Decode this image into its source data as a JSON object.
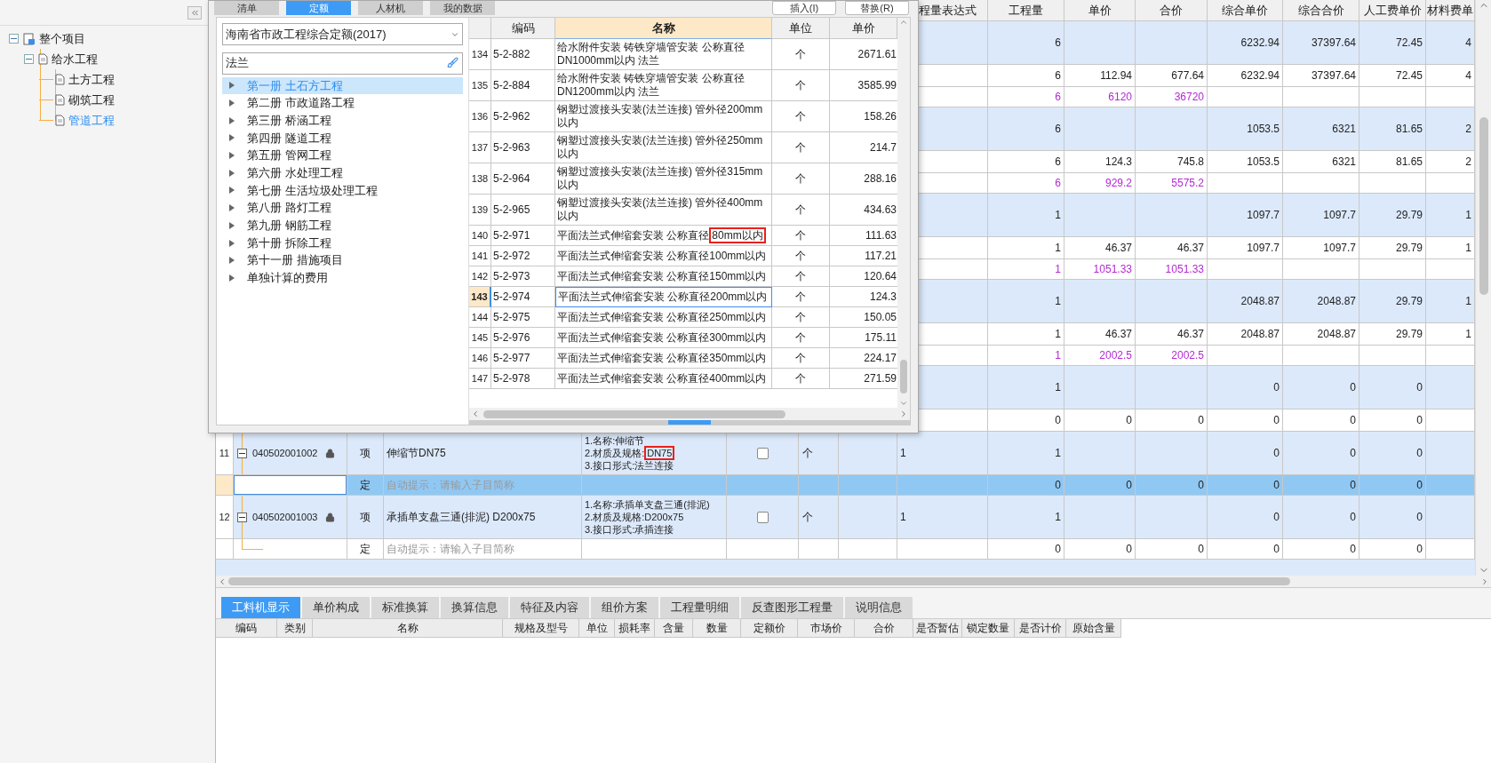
{
  "sidebar": {
    "tree": [
      {
        "label": "整个项目",
        "kind": "project",
        "expanded": true,
        "selected": false,
        "children": [
          {
            "label": "给水工程",
            "kind": "file",
            "expanded": true,
            "selected": false,
            "children": [
              {
                "label": "土方工程",
                "kind": "file",
                "selected": false
              },
              {
                "label": "砌筑工程",
                "kind": "file",
                "selected": false
              },
              {
                "label": "管道工程",
                "kind": "file",
                "selected": true
              }
            ]
          }
        ]
      }
    ]
  },
  "dialog": {
    "tabs": [
      {
        "label": "清单",
        "selected": false
      },
      {
        "label": "定额",
        "selected": true
      },
      {
        "label": "人材机",
        "selected": false
      },
      {
        "label": "我的数据",
        "selected": false
      }
    ],
    "buttons": [
      "插入(I)",
      "替换(R)"
    ],
    "library": "海南省市政工程综合定额(2017)",
    "search": {
      "value": "法兰"
    },
    "chapters": [
      {
        "label": "第一册 土石方工程",
        "selected": true
      },
      {
        "label": "第二册 市政道路工程",
        "selected": false
      },
      {
        "label": "第三册 桥涵工程",
        "selected": false
      },
      {
        "label": "第四册 隧道工程",
        "selected": false
      },
      {
        "label": "第五册 管网工程",
        "selected": false
      },
      {
        "label": "第六册 水处理工程",
        "selected": false
      },
      {
        "label": "第七册 生活垃圾处理工程",
        "selected": false
      },
      {
        "label": "第八册 路灯工程",
        "selected": false
      },
      {
        "label": "第九册 钢筋工程",
        "selected": false
      },
      {
        "label": "第十册 拆除工程",
        "selected": false
      },
      {
        "label": "第十一册 措施项目",
        "selected": false
      },
      {
        "label": "单独计算的费用",
        "selected": false
      }
    ],
    "table": {
      "columns": [
        "编码",
        "名称",
        "单位",
        "单价"
      ],
      "rows": [
        {
          "index": "134",
          "code": "5-2-882",
          "name": "给水附件安装 铸铁穿墙管安装 公称直径DN1000mm以内 法兰",
          "unit": "个",
          "price": "2671.61",
          "selected": false
        },
        {
          "index": "135",
          "code": "5-2-884",
          "name": "给水附件安装 铸铁穿墙管安装 公称直径DN1200mm以内 法兰",
          "unit": "个",
          "price": "3585.99",
          "selected": false
        },
        {
          "index": "136",
          "code": "5-2-962",
          "name": "钢塑过渡接头安装(法兰连接) 管外径200mm以内",
          "unit": "个",
          "price": "158.26",
          "selected": false
        },
        {
          "index": "137",
          "code": "5-2-963",
          "name": "钢塑过渡接头安装(法兰连接) 管外径250mm以内",
          "unit": "个",
          "price": "214.7",
          "selected": false
        },
        {
          "index": "138",
          "code": "5-2-964",
          "name": "钢塑过渡接头安装(法兰连接) 管外径315mm以内",
          "unit": "个",
          "price": "288.16",
          "selected": false
        },
        {
          "index": "139",
          "code": "5-2-965",
          "name": "钢塑过渡接头安装(法兰连接) 管外径400mm以内",
          "unit": "个",
          "price": "434.63",
          "selected": false
        },
        {
          "index": "140",
          "code": "5-2-971",
          "name": "平面法兰式伸缩套安装 公称直径",
          "name_marked": "80mm以内",
          "unit": "个",
          "price": "111.63",
          "selected": false
        },
        {
          "index": "141",
          "code": "5-2-972",
          "name": "平面法兰式伸缩套安装 公称直径100mm以内",
          "unit": "个",
          "price": "117.21",
          "selected": false
        },
        {
          "index": "142",
          "code": "5-2-973",
          "name": "平面法兰式伸缩套安装 公称直径150mm以内",
          "unit": "个",
          "price": "120.64",
          "selected": false
        },
        {
          "index": "143",
          "code": "5-2-974",
          "name": "平面法兰式伸缩套安装 公称直径200mm以内",
          "unit": "个",
          "price": "124.3",
          "selected": true
        },
        {
          "index": "144",
          "code": "5-2-975",
          "name": "平面法兰式伸缩套安装 公称直径250mm以内",
          "unit": "个",
          "price": "150.05",
          "selected": false
        },
        {
          "index": "145",
          "code": "5-2-976",
          "name": "平面法兰式伸缩套安装 公称直径300mm以内",
          "unit": "个",
          "price": "175.11",
          "selected": false
        },
        {
          "index": "146",
          "code": "5-2-977",
          "name": "平面法兰式伸缩套安装 公称直径350mm以内",
          "unit": "个",
          "price": "224.17",
          "selected": false
        },
        {
          "index": "147",
          "code": "5-2-978",
          "name": "平面法兰式伸缩套安装 公称直径400mm以内",
          "unit": "个",
          "price": "271.59",
          "selected": false
        }
      ]
    }
  },
  "main_table": {
    "columns": [
      "程量表达式",
      "工程量",
      "单价",
      "合价",
      "综合单价",
      "综合合价",
      "人工费单价",
      "材料费单"
    ],
    "rows": [
      {
        "kind": "group",
        "selected": false,
        "quantity": "6",
        "composite_unit_price": "6232.94",
        "composite_total": "37397.64",
        "labor_unit_price": "72.45",
        "material_unit_price": "4"
      },
      {
        "kind": "item",
        "selected": false,
        "quantity": "6",
        "unit_price": "112.94",
        "total": "677.64",
        "composite_unit_price": "6232.94",
        "composite_total": "37397.64",
        "labor_unit_price": "72.45",
        "material_unit_price": "4"
      },
      {
        "kind": "resource",
        "selected": false,
        "quantity": "6",
        "unit_price": "6120",
        "total": "36720"
      },
      {
        "kind": "group",
        "selected": false,
        "quantity": "6",
        "composite_unit_price": "1053.5",
        "composite_total": "6321",
        "labor_unit_price": "81.65",
        "material_unit_price": "2"
      },
      {
        "kind": "item",
        "selected": false,
        "quantity": "6",
        "unit_price": "124.3",
        "total": "745.8",
        "composite_unit_price": "1053.5",
        "composite_total": "6321",
        "labor_unit_price": "81.65",
        "material_unit_price": "2"
      },
      {
        "kind": "resource",
        "selected": false,
        "quantity": "6",
        "unit_price": "929.2",
        "total": "5575.2"
      },
      {
        "kind": "group",
        "selected": false,
        "quantity": "1",
        "composite_unit_price": "1097.7",
        "composite_total": "1097.7",
        "labor_unit_price": "29.79",
        "material_unit_price": "1"
      },
      {
        "kind": "item",
        "selected": false,
        "quantity": "1",
        "unit_price": "46.37",
        "total": "46.37",
        "composite_unit_price": "1097.7",
        "composite_total": "1097.7",
        "labor_unit_price": "29.79",
        "material_unit_price": "1"
      },
      {
        "kind": "resource",
        "selected": false,
        "quantity": "1",
        "unit_price": "1051.33",
        "total": "1051.33"
      },
      {
        "kind": "group",
        "selected": false,
        "quantity": "1",
        "composite_unit_price": "2048.87",
        "composite_total": "2048.87",
        "labor_unit_price": "29.79",
        "material_unit_price": "1"
      },
      {
        "kind": "item",
        "selected": false,
        "quantity": "1",
        "unit_price": "46.37",
        "total": "46.37",
        "composite_unit_price": "2048.87",
        "composite_total": "2048.87",
        "labor_unit_price": "29.79",
        "material_unit_price": "1"
      },
      {
        "kind": "resource",
        "selected": false,
        "quantity": "1",
        "unit_price": "2002.5",
        "total": "2002.5"
      },
      {
        "kind": "group",
        "selected": false,
        "quantity": "1",
        "composite_unit_price": "0",
        "composite_total": "0",
        "labor_unit_price": "0"
      },
      {
        "kind": "item",
        "selected": false,
        "quantity": "0",
        "unit_price": "0",
        "total": "0",
        "composite_unit_price": "0",
        "composite_total": "0",
        "labor_unit_price": "0"
      },
      {
        "kind": "group",
        "selected": false,
        "row_number": "11",
        "code": "040502001002",
        "expanded": true,
        "locked": true,
        "type": "项",
        "name": "伸缩节DN75",
        "features": [
          {
            "text": "1.名称:伸缩节"
          },
          {
            "text": "2.材质及规格:",
            "marked": "DN75"
          },
          {
            "text": "3.接口形式:法兰连接"
          }
        ],
        "checked": false,
        "unit": "个",
        "expression": "1",
        "quantity": "1",
        "composite_unit_price": "0",
        "composite_total": "0",
        "labor_unit_price": "0"
      },
      {
        "kind": "auto",
        "selected": true,
        "type": "定",
        "hint": "自动提示：请输入子目简称",
        "quantity": "0",
        "unit_price": "0",
        "total": "0",
        "composite_unit_price": "0",
        "composite_total": "0",
        "labor_unit_price": "0"
      },
      {
        "kind": "group",
        "selected": false,
        "row_number": "12",
        "code": "040502001003",
        "expanded": true,
        "locked": true,
        "type": "项",
        "name": "承插单支盘三通(排泥) D200x75",
        "features": [
          {
            "text": "1.名称:承插单支盘三通(排泥)"
          },
          {
            "text": "2.材质及规格:D200x75"
          },
          {
            "text": "3.接口形式:承插连接"
          }
        ],
        "checked": false,
        "unit": "个",
        "expression": "1",
        "quantity": "1",
        "composite_unit_price": "0",
        "composite_total": "0",
        "labor_unit_price": "0"
      },
      {
        "kind": "auto",
        "selected": false,
        "type": "定",
        "hint": "自动提示：请输入子目简称",
        "quantity": "0",
        "unit_price": "0",
        "total": "0",
        "composite_unit_price": "0",
        "composite_total": "0",
        "labor_unit_price": "0"
      }
    ]
  },
  "bottom_panel": {
    "tabs": [
      {
        "label": "工料机显示",
        "selected": true
      },
      {
        "label": "单价构成",
        "selected": false
      },
      {
        "label": "标准换算",
        "selected": false
      },
      {
        "label": "换算信息",
        "selected": false
      },
      {
        "label": "特征及内容",
        "selected": false
      },
      {
        "label": "组价方案",
        "selected": false
      },
      {
        "label": "工程量明细",
        "selected": false
      },
      {
        "label": "反查图形工程量",
        "selected": false
      },
      {
        "label": "说明信息",
        "selected": false
      }
    ],
    "columns": [
      "编码",
      "类别",
      "名称",
      "规格及型号",
      "单位",
      "损耗率",
      "含量",
      "数量",
      "定额价",
      "市场价",
      "合价",
      "是否暂估",
      "锁定数量",
      "是否计价",
      "原始含量"
    ]
  }
}
